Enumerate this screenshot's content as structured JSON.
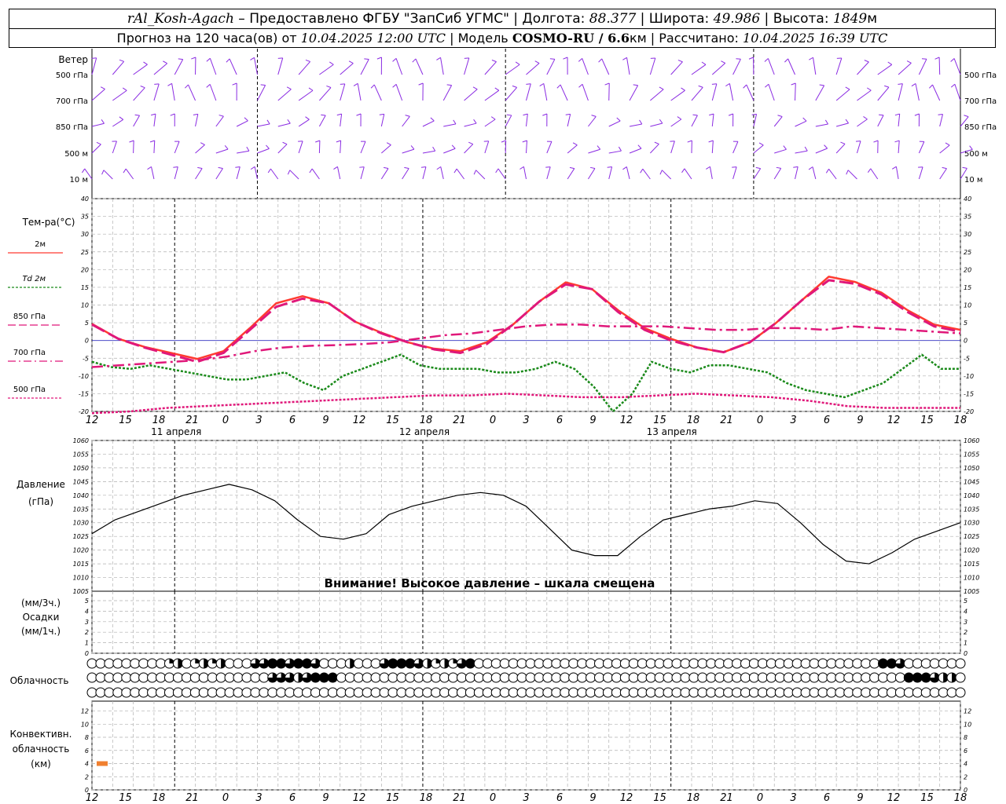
{
  "header": {
    "station": "rAl_Kosh-Agach",
    "provider": " – Предоставлено ФГБУ \"ЗапСиб УГМС\" | Долгота: ",
    "lon": "88.377",
    "lat_label": " | Широта: ",
    "lat": "49.986",
    "alt_label": " | Высота: ",
    "alt": "1849",
    "alt_unit": "м",
    "fc_label": "Прогноз на 120 часа(ов) от ",
    "fc_time": "10.04.2025 12:00 UTC",
    "model_label": " | Модель ",
    "model": "COSMO-RU / 6.6",
    "model_unit": "км",
    "calc_label": " | Рассчитано: ",
    "calc_time": "10.04.2025 16:39 UTC"
  },
  "wind": {
    "title": "Ветер",
    "levels": [
      "500 гПа",
      "700 гПа",
      "850 гПа",
      "500 м",
      "10 м"
    ],
    "color": "#8a2be2"
  },
  "temp_legend": {
    "title": "Тем-ра(°C)",
    "items": [
      {
        "label": "2м",
        "color": "#ff3b30",
        "style": "solid"
      },
      {
        "label": "Td 2м",
        "color": "#1a8a1a",
        "style": "dotted"
      },
      {
        "label": "850 гПа",
        "color": "#e0187a",
        "style": "dash"
      },
      {
        "label": "700 гПа",
        "color": "#e0187a",
        "style": "dashdot"
      },
      {
        "label": "500 гПа",
        "color": "#e0187a",
        "style": "dotted"
      }
    ]
  },
  "time_axis": {
    "ticks": [
      "12",
      "15",
      "18",
      "21",
      "0",
      "3",
      "6",
      "9",
      "12",
      "15",
      "18",
      "21",
      "0",
      "3",
      "6",
      "9",
      "12",
      "15",
      "18",
      "21",
      "0",
      "3",
      "6",
      "9",
      "12",
      "15",
      "18"
    ],
    "dates": [
      "11 апреля",
      "12 апреля",
      "13 апреля"
    ]
  },
  "pressure": {
    "title": "Давление",
    "unit": "(гПа)",
    "warning": "Внимание! Высокое давление – шкала смещена"
  },
  "precip": {
    "label1": "(мм/3ч.)",
    "label2": "Осадки",
    "label3": "(мм/1ч.)",
    "ticks": [
      "0",
      "1",
      "2",
      "3",
      "4",
      "5"
    ]
  },
  "clouds": {
    "title": "Облачность",
    "rows": [
      [
        0,
        0,
        0,
        0,
        0,
        0,
        0,
        0,
        0,
        1,
        2,
        0,
        1,
        2,
        1,
        2,
        0,
        0,
        0,
        3,
        3,
        4,
        4,
        3,
        4,
        4,
        3,
        0,
        0,
        0,
        2,
        0,
        0,
        0,
        3,
        4,
        4,
        4,
        3,
        2,
        1,
        2,
        1,
        3,
        4,
        0,
        0,
        0,
        0,
        0,
        0,
        0,
        0,
        0,
        0,
        0,
        0,
        0,
        0,
        0,
        0,
        0,
        0,
        0,
        0,
        0,
        0,
        0,
        0,
        0,
        0,
        0,
        0,
        0,
        0,
        0,
        0,
        0,
        0,
        0,
        0,
        0,
        0,
        0,
        0,
        0,
        0,
        0,
        0,
        0,
        0,
        0,
        4,
        4,
        3,
        0,
        0,
        0,
        0
      ],
      [
        0,
        0,
        0,
        0,
        0,
        0,
        0,
        0,
        0,
        0,
        0,
        0,
        0,
        0,
        0,
        0,
        0,
        0,
        0,
        0,
        0,
        3,
        3,
        3,
        2,
        3,
        4,
        4,
        4,
        0,
        0,
        0,
        0,
        0,
        0,
        0,
        0,
        0,
        0,
        0,
        0,
        0,
        0,
        0,
        0,
        0,
        0,
        0,
        0,
        0,
        0,
        0,
        0,
        0,
        0,
        0,
        0,
        0,
        0,
        0,
        0,
        0,
        0,
        0,
        0,
        0,
        0,
        0,
        0,
        0,
        0,
        0,
        0,
        0,
        0,
        0,
        0,
        0,
        0,
        0,
        0,
        0,
        0,
        0,
        0,
        0,
        0,
        0,
        0,
        0,
        0,
        0,
        0,
        0,
        0,
        4,
        4,
        4,
        3,
        2,
        2
      ],
      [
        0,
        0,
        0,
        0,
        0,
        0,
        0,
        0,
        0,
        0,
        0,
        0,
        0,
        0,
        0,
        0,
        0,
        0,
        0,
        0,
        0,
        0,
        0,
        0,
        0,
        0,
        0,
        0,
        0,
        0,
        0,
        0,
        0,
        0,
        0,
        0,
        0,
        0,
        0,
        0,
        0,
        0,
        0,
        0,
        0,
        0,
        0,
        0,
        0,
        0,
        0,
        0,
        0,
        0,
        0,
        0,
        0,
        0,
        0,
        0,
        0,
        0,
        0,
        0,
        0,
        0,
        0,
        0,
        0,
        0,
        0,
        0,
        0,
        0,
        0,
        0,
        0,
        0,
        0,
        0,
        0,
        0,
        0,
        0,
        0,
        0,
        0,
        0,
        0,
        0,
        0,
        0,
        0,
        0,
        0,
        0,
        0,
        0,
        0,
        0,
        0,
        0
      ]
    ]
  },
  "convective": {
    "label1": "Конвективн.",
    "label2": "облачность",
    "label3": "(км)",
    "ticks": [
      "0",
      "2",
      "4",
      "6",
      "8",
      "10",
      "12"
    ],
    "color": "#f08030"
  },
  "chart_data": [
    {
      "type": "line",
      "title": "Тем-ра(°C)",
      "ylim": [
        -20,
        40
      ],
      "x": [
        0,
        3,
        6,
        9,
        12,
        15,
        18,
        21,
        24,
        27,
        30,
        33,
        36,
        39,
        42,
        45,
        48,
        51,
        54,
        57,
        60,
        63,
        66,
        69,
        72,
        75,
        78,
        81,
        84,
        87,
        90,
        93,
        96,
        99,
        102,
        105,
        108,
        111,
        114,
        117,
        120,
        123,
        126
      ],
      "series": [
        {
          "name": "2м",
          "values": [
            4.7,
            0.5,
            -1.8,
            -3.5,
            -5.2,
            -3,
            3.5,
            10.5,
            12.5,
            10.5,
            5.3,
            2.2,
            -0.5,
            -2.3,
            -3,
            -0.5,
            4.5,
            11,
            16.4,
            14.5,
            8.5,
            3.5,
            0.5,
            -2,
            -3.3,
            -0.5,
            5,
            11.5,
            18,
            16.5,
            13.5,
            8.5,
            4.5,
            3
          ]
        },
        {
          "name": "Td 2м",
          "values": [
            -6,
            -7.5,
            -8,
            -7,
            -8,
            -9,
            -10,
            -11,
            -11,
            -10,
            -9,
            -12,
            -14,
            -10,
            -8,
            -6,
            -4,
            -7,
            -8,
            -8,
            -8,
            -9,
            -9,
            -8,
            -6,
            -8,
            -13,
            -20,
            -15,
            -6,
            -8,
            -9,
            -7,
            -7,
            -8,
            -9,
            -12,
            -14,
            -15,
            -16,
            -14,
            -12,
            -8,
            -4,
            -8,
            -8
          ]
        },
        {
          "name": "850 гПа",
          "values": [
            4.5,
            0.5,
            -2,
            -4,
            -6,
            -3.5,
            3,
            9.5,
            11.8,
            10.5,
            5.3,
            2,
            -0.5,
            -2.5,
            -3.5,
            -1,
            4.5,
            11,
            15.8,
            14.5,
            8,
            3,
            0,
            -2,
            -3.3,
            -0.5,
            5,
            11.5,
            17,
            16,
            13,
            8,
            4,
            2.5
          ]
        },
        {
          "name": "700 гПа",
          "values": [
            -7.5,
            -7,
            -6.5,
            -6,
            -5.5,
            -4.5,
            -3,
            -2,
            -1.5,
            -1.3,
            -1,
            -0.5,
            0.5,
            1.5,
            2,
            3,
            4,
            4.5,
            4.5,
            4,
            4,
            4,
            3.5,
            3,
            3,
            3.5,
            3.5,
            3,
            4,
            3.5,
            3,
            2.5,
            2
          ]
        },
        {
          "name": "500 гПа",
          "values": [
            -20.5,
            -20,
            -19,
            -18.5,
            -18,
            -17.5,
            -17,
            -16.5,
            -16,
            -15.5,
            -15.5,
            -15,
            -15.5,
            -16,
            -16,
            -15.5,
            -15,
            -15.5,
            -16,
            -17,
            -18.5,
            -19,
            -19,
            -19
          ]
        }
      ]
    },
    {
      "type": "line",
      "title": "Давление",
      "ylabel": "(гПа)",
      "ylim": [
        1005,
        1060
      ],
      "x": [
        0,
        3,
        6,
        9,
        12,
        15,
        18,
        21,
        24,
        27,
        30,
        33,
        36,
        39,
        42,
        45,
        48,
        51,
        54,
        57,
        60,
        63,
        66,
        69,
        72,
        75,
        78,
        81,
        84,
        87,
        90,
        93,
        96,
        99,
        102,
        105,
        108,
        111,
        114,
        117,
        120,
        123,
        126
      ],
      "series": [
        {
          "name": "",
          "values": [
            1026,
            1031,
            1034,
            1037,
            1040,
            1042,
            1044,
            1042,
            1038,
            1031,
            1025,
            1024,
            1026,
            1033,
            1036,
            1038,
            1040,
            1041,
            1040,
            1036,
            1028,
            1020,
            1018,
            1018,
            1025,
            1031,
            1033,
            1035,
            1036,
            1038,
            1037,
            1030,
            1022,
            1016,
            1015,
            1019,
            1024,
            1027,
            1030
          ]
        }
      ]
    },
    {
      "type": "bar",
      "title": "Конвективн. облачность (км)",
      "ylim": [
        0,
        13
      ],
      "x": [
        0
      ],
      "values": [
        4
      ]
    }
  ]
}
